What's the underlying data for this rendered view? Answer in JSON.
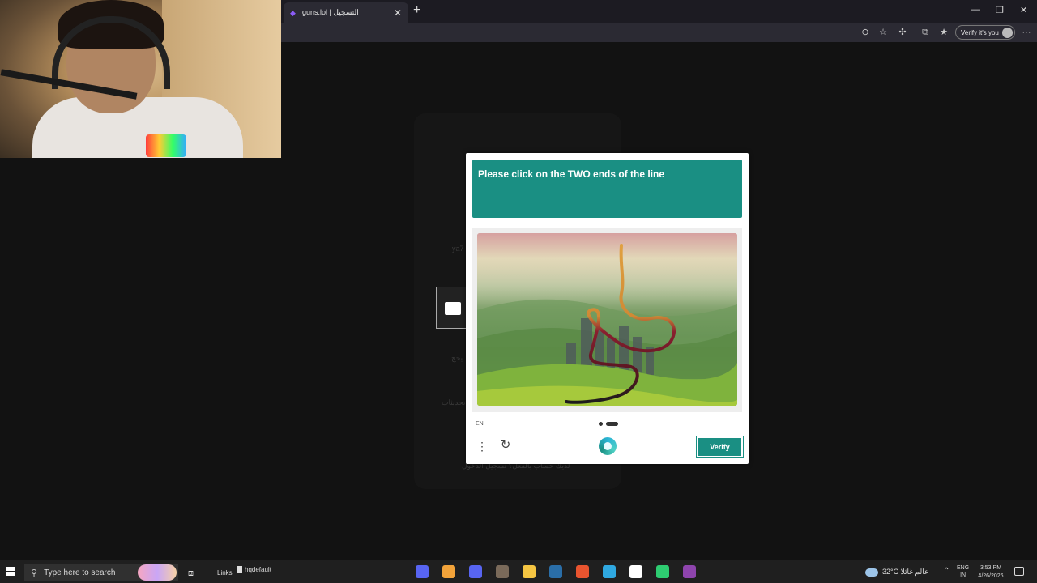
{
  "browser": {
    "tab_title": "guns.lol | التسجيل",
    "new_tab_symbol": "+",
    "tab_close_symbol": "✕",
    "profile_pill_label": "Verify it's you",
    "window_controls": [
      "—",
      "❐",
      "✕"
    ]
  },
  "page": {
    "ghost_username": "ya7",
    "ghost_email_hint": "يحج",
    "ghost_updates": "تحديثات",
    "ghost_footer": "لديك حساب بالفعل؟ تسجيل الدخول"
  },
  "captcha": {
    "prompt": "Please click on the TWO ends of the line",
    "language": "EN",
    "verify_label": "Verify",
    "menu_symbol": "⋮",
    "refresh_symbol": "↻",
    "colors": {
      "accent": "#1a8f83",
      "line_start": "#e0a040",
      "line_mid": "#8a1f2f",
      "line_end": "#1c1c1c"
    }
  },
  "taskbar": {
    "search_placeholder": "Type here to search",
    "links_label": "Links",
    "pinned_file": "hqdefault",
    "weather": "32°C  عالم غائلا",
    "language_top": "ENG",
    "language_bottom": "IN",
    "time": "3:53 PM",
    "date": "4/26/2026",
    "apps": [
      {
        "name": "discord-icon",
        "color": "#5865f2"
      },
      {
        "name": "app-orange-icon",
        "color": "#f2a33a"
      },
      {
        "name": "discord-alt-icon",
        "color": "#5865f2"
      },
      {
        "name": "game-icon",
        "color": "#7a6a5a"
      },
      {
        "name": "file-explorer-icon",
        "color": "#f5c542"
      },
      {
        "name": "steam-icon",
        "color": "#2a6ea8"
      },
      {
        "name": "app-red-icon",
        "color": "#e8542f"
      },
      {
        "name": "edge-icon",
        "color": "#2fa8e0"
      },
      {
        "name": "capcut-icon",
        "color": "#ffffff"
      },
      {
        "name": "app-green-icon",
        "color": "#2ecc71"
      },
      {
        "name": "app-purple-icon",
        "color": "#8e44ad"
      }
    ]
  }
}
